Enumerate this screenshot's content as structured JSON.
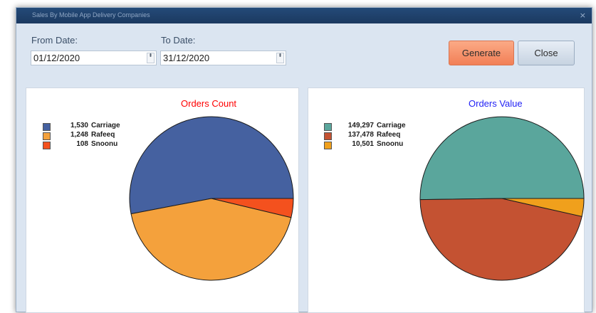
{
  "window": {
    "title": "Sales By Mobile App Delivery Companies",
    "close_glyph": "×"
  },
  "filters": {
    "from_label": "From Date:",
    "from_value": "01/12/2020",
    "to_label": "To Date:",
    "to_value": "31/12/2020",
    "spin_glyph": "⬍"
  },
  "buttons": {
    "generate_label": "Generate",
    "close_label": "Close"
  },
  "charts": {
    "left": {
      "title": "Orders Count",
      "title_color": "#ff0000"
    },
    "right": {
      "title": "Orders Value",
      "title_color": "#1f1ff5"
    }
  },
  "chart_data": [
    {
      "type": "pie",
      "title": "Orders Count",
      "legend_position": "top-left",
      "slices": [
        {
          "label": "Carriage",
          "value": 1530,
          "display": "1,530",
          "color": "#4561a0"
        },
        {
          "label": "Rafeeq",
          "value": 1248,
          "display": "1,248",
          "color": "#f4a13c"
        },
        {
          "label": "Snoonu",
          "value": 108,
          "display": "108",
          "color": "#f4511e"
        }
      ]
    },
    {
      "type": "pie",
      "title": "Orders Value",
      "legend_position": "top-left",
      "slices": [
        {
          "label": "Carriage",
          "value": 149297,
          "display": "149,297",
          "color": "#5aa69c"
        },
        {
          "label": "Rafeeq",
          "value": 137478,
          "display": "137,478",
          "color": "#c45232"
        },
        {
          "label": "Snoonu",
          "value": 10501,
          "display": "10,501",
          "color": "#f0a01c"
        }
      ]
    }
  ]
}
